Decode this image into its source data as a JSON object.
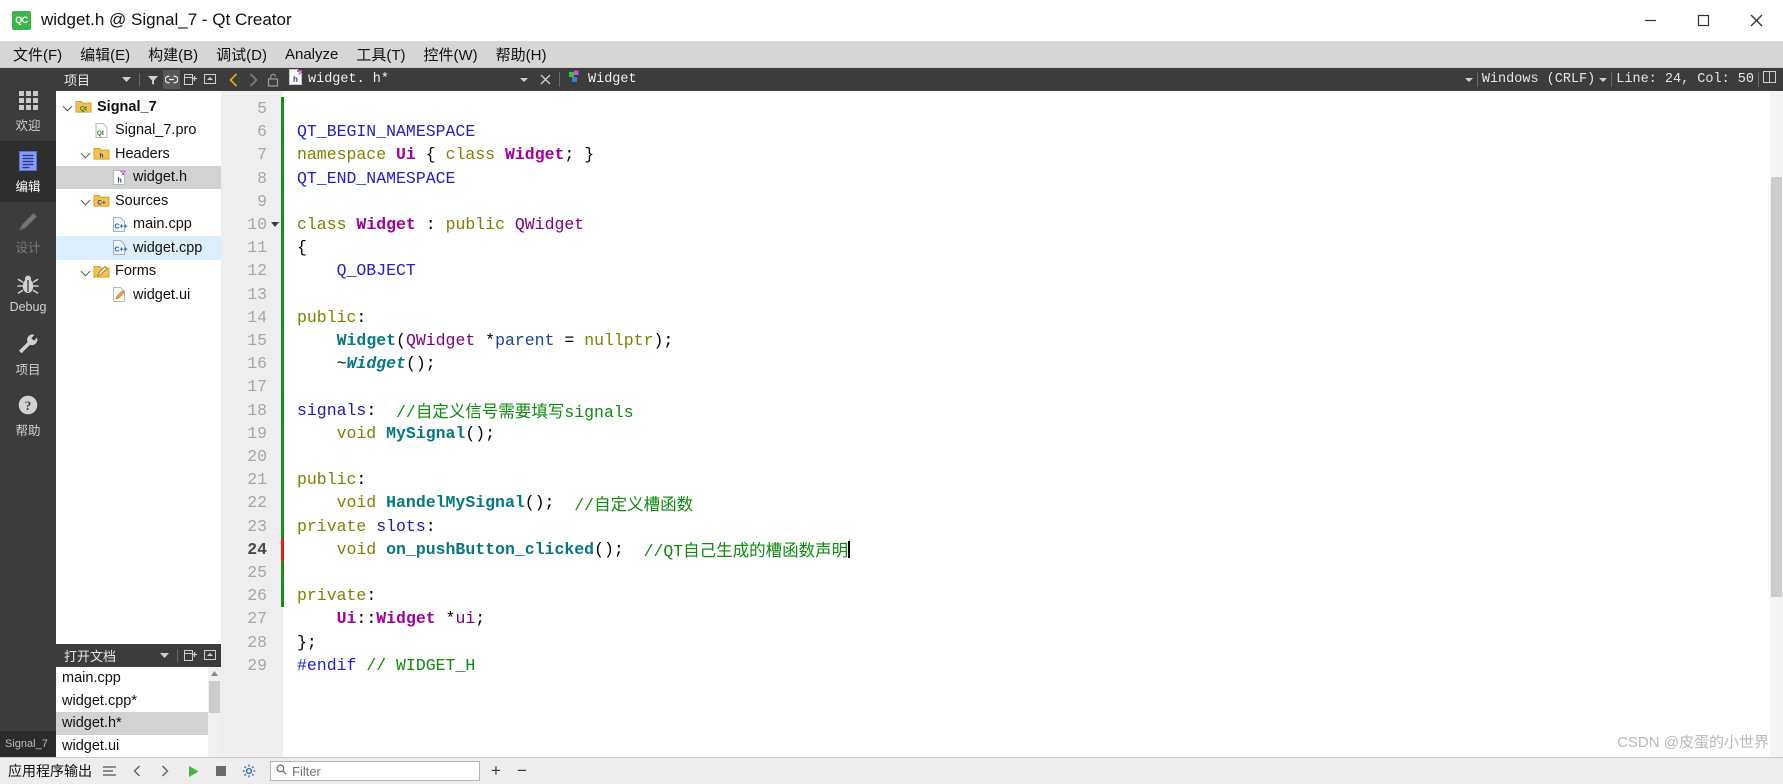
{
  "window": {
    "title": "widget.h @ Signal_7 - Qt Creator",
    "app_icon_text": "QC",
    "minimize": "─",
    "maximize": "□",
    "close": "✕"
  },
  "menubar": {
    "items": [
      {
        "label": "文件(F)",
        "name": "menu-file"
      },
      {
        "label": "编辑(E)",
        "name": "menu-edit"
      },
      {
        "label": "构建(B)",
        "name": "menu-build"
      },
      {
        "label": "调试(D)",
        "name": "menu-debug"
      },
      {
        "label": "Analyze",
        "name": "menu-analyze"
      },
      {
        "label": "工具(T)",
        "name": "menu-tools"
      },
      {
        "label": "控件(W)",
        "name": "menu-window"
      },
      {
        "label": "帮助(H)",
        "name": "menu-help"
      }
    ]
  },
  "modebar": {
    "items": [
      {
        "label": "欢迎",
        "icon": "grid-icon",
        "state": "normal"
      },
      {
        "label": "编辑",
        "icon": "document-icon",
        "state": "active"
      },
      {
        "label": "设计",
        "icon": "pencil-icon",
        "state": "disabled"
      },
      {
        "label": "Debug",
        "icon": "bug-icon",
        "state": "normal"
      },
      {
        "label": "项目",
        "icon": "wrench-icon",
        "state": "normal"
      },
      {
        "label": "帮助",
        "icon": "question-icon",
        "state": "normal"
      }
    ],
    "project_label": "Signal_7"
  },
  "project_dock": {
    "title": "项目",
    "toolbar": [
      "filter-icon",
      "link-icon",
      "expand-icon",
      "collapse-icon"
    ],
    "tree": [
      {
        "label": "Signal_7",
        "indent": 0,
        "icon": "qt-folder-icon",
        "expanded": true,
        "bold": true,
        "selected": "none"
      },
      {
        "label": "Signal_7.pro",
        "indent": 1,
        "icon": "qt-pro-file-icon",
        "expanded": null,
        "bold": false,
        "selected": "none"
      },
      {
        "label": "Headers",
        "indent": 1,
        "icon": "h-folder-icon",
        "expanded": true,
        "bold": false,
        "selected": "none"
      },
      {
        "label": "widget.h",
        "indent": 2,
        "icon": "h-file-icon",
        "expanded": null,
        "bold": false,
        "selected": "gray"
      },
      {
        "label": "Sources",
        "indent": 1,
        "icon": "cpp-folder-icon",
        "expanded": true,
        "bold": false,
        "selected": "none"
      },
      {
        "label": "main.cpp",
        "indent": 2,
        "icon": "cpp-file-icon",
        "expanded": null,
        "bold": false,
        "selected": "none"
      },
      {
        "label": "widget.cpp",
        "indent": 2,
        "icon": "cpp-file-icon",
        "expanded": null,
        "bold": false,
        "selected": "blue"
      },
      {
        "label": "Forms",
        "indent": 1,
        "icon": "ui-folder-icon",
        "expanded": true,
        "bold": false,
        "selected": "none"
      },
      {
        "label": "widget.ui",
        "indent": 2,
        "icon": "ui-file-icon",
        "expanded": null,
        "bold": false,
        "selected": "none"
      }
    ]
  },
  "open_documents": {
    "title": "打开文档",
    "items": [
      {
        "label": "main.cpp",
        "selected": false
      },
      {
        "label": "widget.cpp*",
        "selected": false
      },
      {
        "label": "widget.h*",
        "selected": true
      },
      {
        "label": "widget.ui",
        "selected": false
      }
    ]
  },
  "editor_bar": {
    "back_icon": "chevron-left-icon",
    "forward_icon": "chevron-right-icon",
    "lock_icon": "unlock-icon",
    "file_icon": "h-file-icon",
    "file_name": "widget. h*",
    "close_icon": "close-icon",
    "symbol_icon": "class-symbol-icon",
    "symbol_name": "Widget",
    "line_ending": "Windows  (CRLF)",
    "cursor_position": "Line: 24, Col: 50",
    "split_icon": "split-editor-icon"
  },
  "code": {
    "first_line_number": 5,
    "current_line": 24,
    "lines": [
      {
        "n": 5,
        "fold": false,
        "mark": "green",
        "tokens": []
      },
      {
        "n": 6,
        "fold": false,
        "mark": "green",
        "tokens": [
          {
            "t": "QT_BEGIN_NAMESPACE",
            "c": "macro"
          }
        ]
      },
      {
        "n": 7,
        "fold": false,
        "mark": "green",
        "tokens": [
          {
            "t": "namespace ",
            "c": "kw"
          },
          {
            "t": "Ui",
            "c": "type2"
          },
          {
            "t": " { ",
            "c": "pl"
          },
          {
            "t": "class ",
            "c": "kw"
          },
          {
            "t": "Widget",
            "c": "type2"
          },
          {
            "t": "; }",
            "c": "pl"
          }
        ]
      },
      {
        "n": 8,
        "fold": false,
        "mark": "green",
        "tokens": [
          {
            "t": "QT_END_NAMESPACE",
            "c": "macro"
          }
        ]
      },
      {
        "n": 9,
        "fold": false,
        "mark": "green",
        "tokens": []
      },
      {
        "n": 10,
        "fold": true,
        "mark": "green",
        "tokens": [
          {
            "t": "class ",
            "c": "kw"
          },
          {
            "t": "Widget",
            "c": "type2"
          },
          {
            "t": " : ",
            "c": "pl"
          },
          {
            "t": "public ",
            "c": "kw"
          },
          {
            "t": "QWidget",
            "c": "type"
          }
        ]
      },
      {
        "n": 11,
        "fold": false,
        "mark": "green",
        "tokens": [
          {
            "t": "{",
            "c": "pl"
          }
        ]
      },
      {
        "n": 12,
        "fold": false,
        "mark": "green",
        "tokens": [
          {
            "t": "    Q_OBJECT",
            "c": "macro"
          }
        ]
      },
      {
        "n": 13,
        "fold": false,
        "mark": "green",
        "tokens": []
      },
      {
        "n": 14,
        "fold": false,
        "mark": "green",
        "tokens": [
          {
            "t": "public",
            "c": "kw"
          },
          {
            "t": ":",
            "c": "pl"
          }
        ]
      },
      {
        "n": 15,
        "fold": false,
        "mark": "green",
        "tokens": [
          {
            "t": "    ",
            "c": "pl"
          },
          {
            "t": "Widget",
            "c": "fn"
          },
          {
            "t": "(",
            "c": "pl"
          },
          {
            "t": "QWidget",
            "c": "type"
          },
          {
            "t": " *",
            "c": "pl"
          },
          {
            "t": "parent",
            "c": "var"
          },
          {
            "t": " = ",
            "c": "pl"
          },
          {
            "t": "nullptr",
            "c": "kw"
          },
          {
            "t": ");",
            "c": "pl"
          }
        ]
      },
      {
        "n": 16,
        "fold": false,
        "mark": "green",
        "tokens": [
          {
            "t": "    ~",
            "c": "pl"
          },
          {
            "t": "Widget",
            "c": "fni"
          },
          {
            "t": "();",
            "c": "pl"
          }
        ]
      },
      {
        "n": 17,
        "fold": false,
        "mark": "green",
        "tokens": []
      },
      {
        "n": 18,
        "fold": false,
        "mark": "green",
        "tokens": [
          {
            "t": "signals",
            "c": "kw2"
          },
          {
            "t": ":  ",
            "c": "pl"
          },
          {
            "t": "//自定义信号需要填写signals",
            "c": "cmt"
          }
        ]
      },
      {
        "n": 19,
        "fold": false,
        "mark": "green",
        "tokens": [
          {
            "t": "    void ",
            "c": "kw"
          },
          {
            "t": "MySignal",
            "c": "fn"
          },
          {
            "t": "();",
            "c": "pl"
          }
        ]
      },
      {
        "n": 20,
        "fold": false,
        "mark": "green",
        "tokens": []
      },
      {
        "n": 21,
        "fold": false,
        "mark": "green",
        "tokens": [
          {
            "t": "public",
            "c": "kw"
          },
          {
            "t": ":",
            "c": "pl"
          }
        ]
      },
      {
        "n": 22,
        "fold": false,
        "mark": "green",
        "tokens": [
          {
            "t": "    void ",
            "c": "kw"
          },
          {
            "t": "HandelMySignal",
            "c": "fn"
          },
          {
            "t": "();  ",
            "c": "pl"
          },
          {
            "t": "//自定义槽函数",
            "c": "cmt"
          }
        ]
      },
      {
        "n": 23,
        "fold": false,
        "mark": "green",
        "tokens": [
          {
            "t": "private ",
            "c": "kw"
          },
          {
            "t": "slots",
            "c": "kw2"
          },
          {
            "t": ":",
            "c": "pl"
          }
        ]
      },
      {
        "n": 24,
        "fold": false,
        "mark": "red",
        "tokens": [
          {
            "t": "    void ",
            "c": "kw"
          },
          {
            "t": "on_pushButton_clicked",
            "c": "fn"
          },
          {
            "t": "();  ",
            "c": "pl"
          },
          {
            "t": "//QT自己生成的槽函数声明",
            "c": "cmt"
          }
        ],
        "caret": true
      },
      {
        "n": 25,
        "fold": false,
        "mark": "green",
        "tokens": []
      },
      {
        "n": 26,
        "fold": false,
        "mark": "green",
        "tokens": [
          {
            "t": "private",
            "c": "kw"
          },
          {
            "t": ":",
            "c": "pl"
          }
        ]
      },
      {
        "n": 27,
        "fold": false,
        "mark": "none",
        "tokens": [
          {
            "t": "    ",
            "c": "pl"
          },
          {
            "t": "Ui",
            "c": "type2"
          },
          {
            "t": "::",
            "c": "pl"
          },
          {
            "t": "Widget",
            "c": "type2"
          },
          {
            "t": " *",
            "c": "pl"
          },
          {
            "t": "ui",
            "c": "type"
          },
          {
            "t": ";",
            "c": "pl"
          }
        ]
      },
      {
        "n": 28,
        "fold": false,
        "mark": "none",
        "tokens": [
          {
            "t": "};",
            "c": "pl"
          }
        ]
      },
      {
        "n": 29,
        "fold": false,
        "mark": "none",
        "tokens": [
          {
            "t": "#endif ",
            "c": "pre"
          },
          {
            "t": "// WIDGET_H",
            "c": "cmt"
          }
        ]
      }
    ]
  },
  "bottom_bar": {
    "title": "应用程序输出",
    "buttons": [
      "wrap-lines-icon",
      "prev-icon",
      "next-icon",
      "run-icon",
      "stop-icon",
      "settings-icon"
    ],
    "filter_placeholder": "Filter",
    "filter_value": "",
    "search_icon": "search-icon",
    "zoom_in": "+",
    "zoom_out": "−"
  },
  "watermark": "CSDN @皮蛋的小世界",
  "colors": {
    "mode_bg": "#3c3c3c",
    "accent_blue": "#2121c9",
    "comment_green": "#0e8a0e",
    "keyword_olive": "#808000",
    "function_teal": "#06787f",
    "type_purple": "#800080",
    "change_green": "#1f8a1f",
    "change_red": "#e02020",
    "selection_gray": "#d2d2d2",
    "selection_blue": "#dceefb"
  }
}
